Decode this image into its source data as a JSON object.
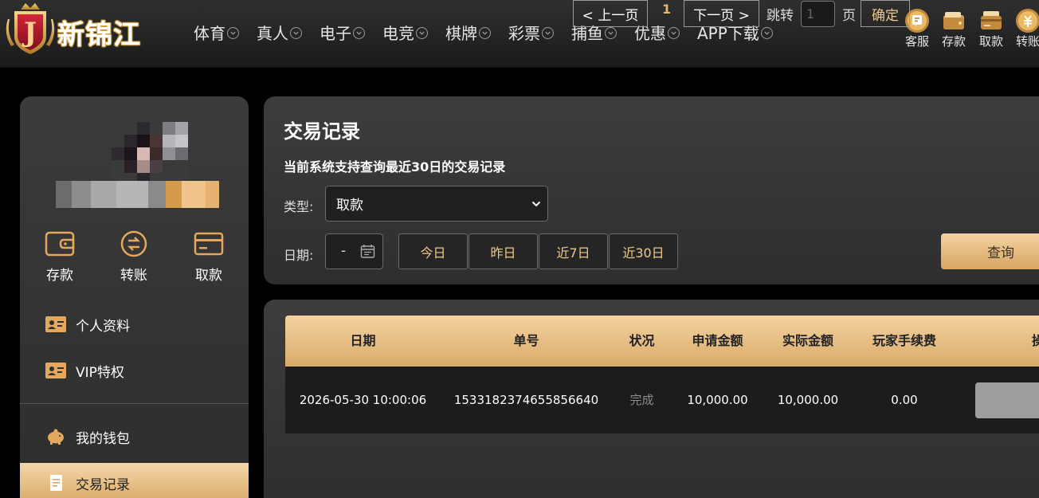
{
  "header": {
    "logo_text": "新锦江",
    "nav": [
      {
        "label": "体育"
      },
      {
        "label": "真人"
      },
      {
        "label": "电子"
      },
      {
        "label": "电竞"
      },
      {
        "label": "棋牌"
      },
      {
        "label": "彩票"
      },
      {
        "label": "捕鱼"
      },
      {
        "label": "优惠"
      },
      {
        "label": "APP下载"
      }
    ],
    "quick": {
      "service": "客服",
      "deposit": "存款",
      "withdraw": "取款",
      "transfer": "转账"
    }
  },
  "sidebar": {
    "quick": {
      "deposit": "存款",
      "transfer": "转账",
      "withdraw": "取款"
    },
    "menu": {
      "profile": "个人资料",
      "vip": "VIP特权",
      "wallet": "我的钱包",
      "transactions": "交易记录"
    }
  },
  "filters": {
    "title": "交易记录",
    "subtitle": "当前系统支持查询最近30日的交易记录",
    "type_label": "类型:",
    "type_value": "取款",
    "date_label": "日期:",
    "date_value": "-",
    "ranges": {
      "today": "今日",
      "yesterday": "昨日",
      "last7": "近7日",
      "last30": "近30日"
    },
    "query_label": "查询"
  },
  "table": {
    "headers": {
      "date": "日期",
      "order_no": "单号",
      "status": "状况",
      "requested": "申请金额",
      "actual": "实际金额",
      "fee": "玩家手续费",
      "action": "操"
    },
    "rows": [
      {
        "date": "2026-05-30 10:00:06",
        "order_no": "1533182374655856640",
        "status": "完成",
        "requested": "10,000.00",
        "actual": "10,000.00",
        "fee": "0.00"
      }
    ]
  },
  "pagination": {
    "prev": "< 上一页",
    "current": "1",
    "next": "下一页 >",
    "jump_label": "跳转",
    "jump_value": "1",
    "page_unit": "页",
    "confirm": "确定"
  },
  "colors": {
    "accent_gold": "#e7b66d",
    "gold_gradient_top": "#f3d2a1",
    "gold_gradient_bottom": "#d9ab69",
    "panel": "#353535",
    "background": "#000000"
  }
}
